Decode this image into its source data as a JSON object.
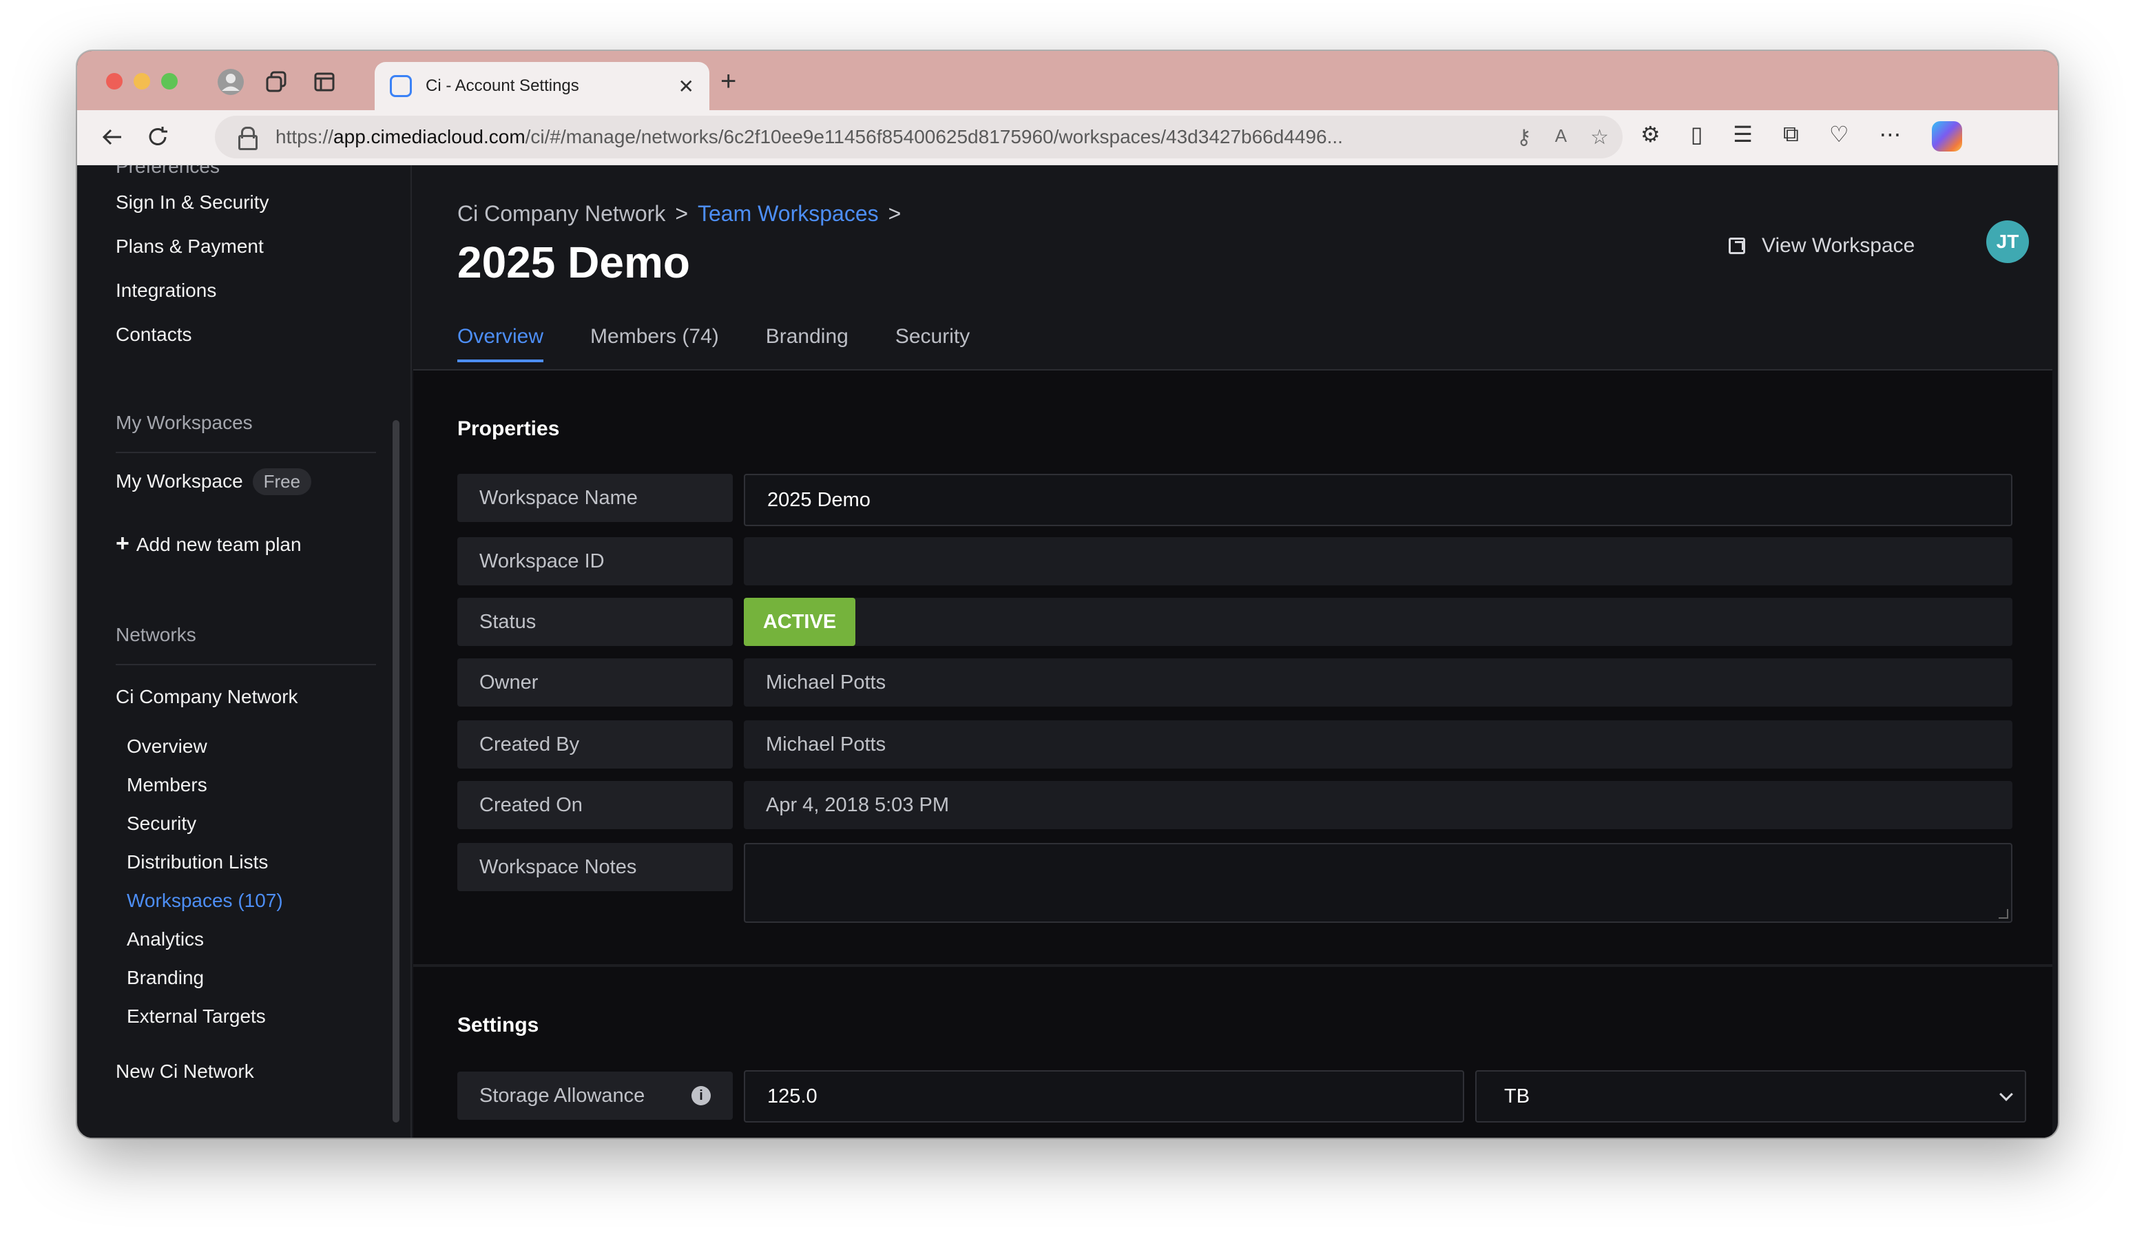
{
  "browser": {
    "tab_title": "Ci - Account Settings",
    "url_prefix": "https://",
    "url_host": "app.cimediacloud.com",
    "url_path": "/ci/#/manage/networks/6c2f10ee9e11456f85400625d8175960/workspaces/43d3427b66d4496..."
  },
  "sidebar": {
    "top_items": [
      "Sign In & Security",
      "Plans & Payment",
      "Integrations",
      "Contacts"
    ],
    "my_workspaces_heading": "My Workspaces",
    "my_workspace_label": "My Workspace",
    "my_workspace_badge": "Free",
    "add_plan_label": "Add new team plan",
    "networks_heading": "Networks",
    "network_name": "Ci Company Network",
    "network_sub_items": [
      "Overview",
      "Members",
      "Security",
      "Distribution Lists",
      "Workspaces (107)",
      "Analytics",
      "Branding",
      "External Targets"
    ],
    "new_network_label": "New Ci Network"
  },
  "header": {
    "breadcrumb_network": "Ci Company Network",
    "breadcrumb_sep": ">",
    "breadcrumb_team": "Team Workspaces",
    "title": "2025 Demo",
    "view_workspace_label": "View Workspace",
    "avatar_initials": "JT",
    "help_glyph": "?",
    "tabs": [
      "Overview",
      "Members (74)",
      "Branding",
      "Security"
    ]
  },
  "properties": {
    "heading": "Properties",
    "workspace_name_label": "Workspace Name",
    "workspace_name_value": "2025 Demo",
    "workspace_id_label": "Workspace ID",
    "workspace_id_value": "",
    "status_label": "Status",
    "status_value": "ACTIVE",
    "owner_label": "Owner",
    "owner_value": "Michael Potts",
    "created_by_label": "Created By",
    "created_by_value": "Michael Potts",
    "created_on_label": "Created On",
    "created_on_value": "Apr 4, 2018 5:03 PM",
    "notes_label": "Workspace Notes",
    "notes_value": ""
  },
  "settings": {
    "heading": "Settings",
    "storage_label": "Storage Allowance",
    "storage_value": "125.0",
    "storage_unit": "TB"
  },
  "colors": {
    "accent_blue": "#4d8ef5",
    "status_active": "#75b33c",
    "avatar": "#3fa9b2"
  }
}
